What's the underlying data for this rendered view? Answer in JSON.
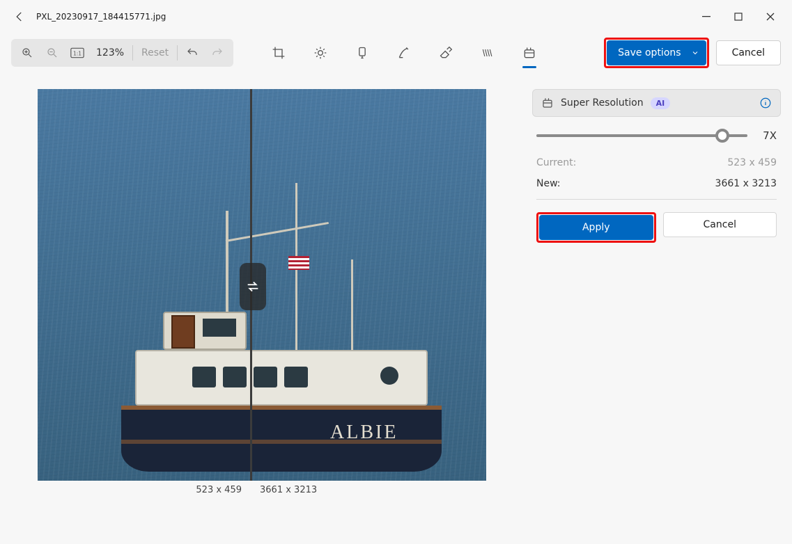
{
  "header": {
    "filename": "PXL_20230917_184415771.jpg"
  },
  "zoom": {
    "value": "123%",
    "reset_label": "Reset"
  },
  "actions": {
    "save_label": "Save options",
    "cancel_label": "Cancel"
  },
  "canvas": {
    "boat_name": "ALBIE",
    "left_dim": "523 x 459",
    "right_dim": "3661 x 3213"
  },
  "panel": {
    "title": "Super Resolution",
    "ai_badge": "AI",
    "slider_value": "7X",
    "current_label": "Current:",
    "current_value": "523 x 459",
    "new_label": "New:",
    "new_value": "3661 x 3213",
    "apply_label": "Apply",
    "cancel_label": "Cancel"
  }
}
